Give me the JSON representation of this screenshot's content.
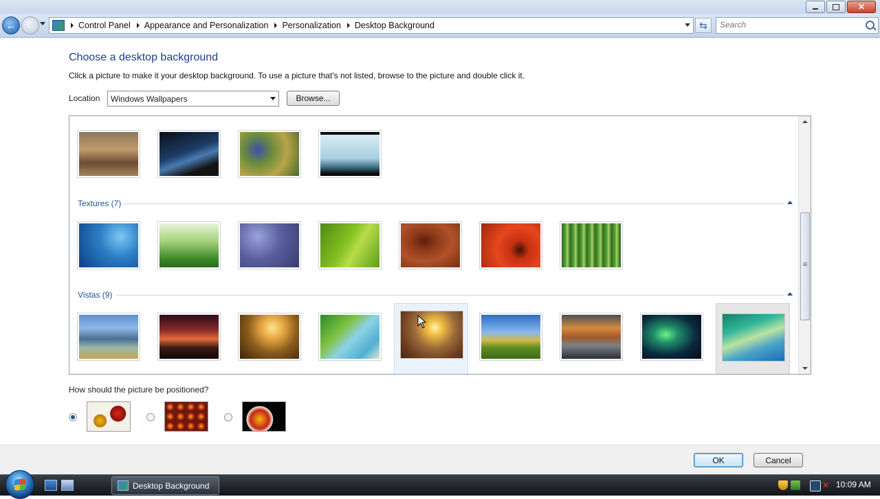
{
  "window": {
    "buttons": {
      "minimize": "",
      "maximize": "",
      "close": ""
    }
  },
  "address_bar": {
    "breadcrumbs": [
      "Control Panel",
      "Appearance and Personalization",
      "Personalization",
      "Desktop Background"
    ],
    "search_placeholder": "Search"
  },
  "page": {
    "title": "Choose a desktop background",
    "instructions": "Click a picture to make it your desktop background. To use a picture that's not listed, browse to the picture and double click it.",
    "location_label": "Location",
    "location_value": "Windows Wallpapers",
    "browse_label": "Browse..."
  },
  "gallery": {
    "categories": [
      {
        "label": "",
        "thumbnails": [
          "painting-park",
          "bridge-night",
          "irises",
          "koi-fish"
        ]
      },
      {
        "label": "Textures (7)",
        "thumbnails": [
          "fish-school",
          "green-grass",
          "pebbles",
          "green-leaf",
          "wood-grain",
          "red-gerbera",
          "bamboo"
        ]
      },
      {
        "label": "Vistas (9)",
        "thumbnails": [
          "karst-river",
          "sunset-hills",
          "golden-rocks",
          "palm-frond",
          "field-sunrise",
          "green-valley",
          "rock-reflection",
          "aurora",
          "vista-aurora"
        ]
      }
    ],
    "hovered_thumbnail": "field-sunrise",
    "selected_thumbnail": "vista-aurora"
  },
  "positioning": {
    "question": "How should the picture be positioned?",
    "options": [
      "fit-to-screen",
      "tile",
      "center"
    ],
    "selected": "fit-to-screen"
  },
  "dialog_buttons": {
    "ok": "OK",
    "cancel": "Cancel"
  },
  "taskbar": {
    "task_label": "Desktop Background",
    "clock": "10:09 AM"
  },
  "colors": {
    "title_blue": "#1e3f8b",
    "link_blue": "#1e4e9a",
    "taskbar": "#111418"
  }
}
